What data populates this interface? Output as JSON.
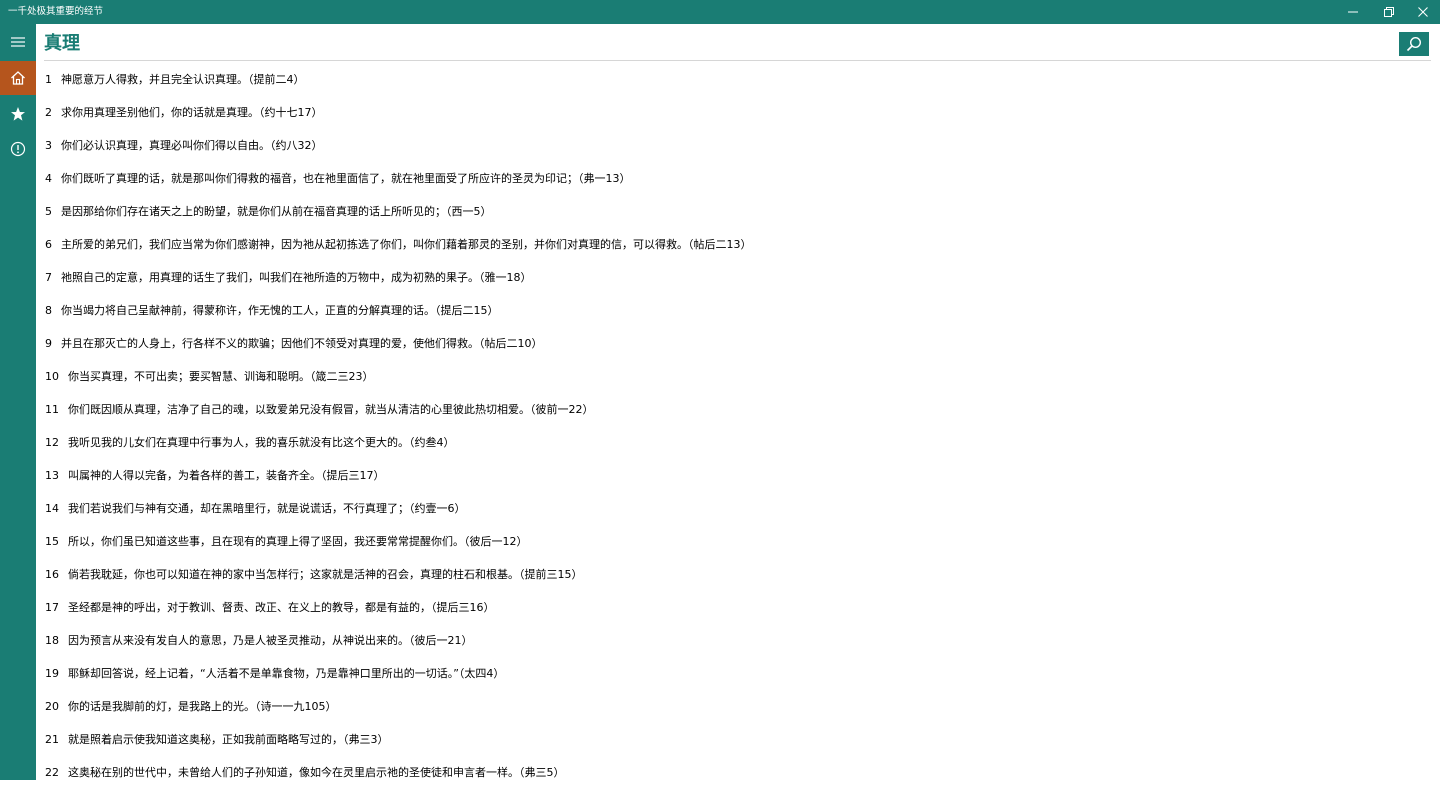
{
  "window": {
    "title": "一千处极其重要的经节",
    "controls": [
      {
        "name": "minimize-icon"
      },
      {
        "name": "restore-icon"
      },
      {
        "name": "close-icon"
      }
    ]
  },
  "sidebar": {
    "items": [
      {
        "name": "hamburger-menu-icon"
      },
      {
        "name": "home-icon",
        "active": true
      },
      {
        "name": "star-icon"
      },
      {
        "name": "info-icon"
      }
    ]
  },
  "header": {
    "title": "真理",
    "search_icon": "search-icon"
  },
  "colors": {
    "accent": "#1a7d74",
    "active_nav": "#b5551d",
    "background": "#ffffff"
  },
  "verses": [
    {
      "num": "1",
      "text": "神愿意万人得救，并且完全认识真理。（提前二4）"
    },
    {
      "num": "2",
      "text": "求你用真理圣别他们，你的话就是真理。（约十七17）"
    },
    {
      "num": "3",
      "text": "你们必认识真理，真理必叫你们得以自由。（约八32）"
    },
    {
      "num": "4",
      "text": "你们既听了真理的话，就是那叫你们得救的福音，也在祂里面信了，就在祂里面受了所应许的圣灵为印记；（弗一13）"
    },
    {
      "num": "5",
      "text": "是因那给你们存在诸天之上的盼望，就是你们从前在福音真理的话上所听见的；（西一5）"
    },
    {
      "num": "6",
      "text": "主所爱的弟兄们，我们应当常为你们感谢神，因为祂从起初拣选了你们，叫你们藉着那灵的圣别，并你们对真理的信，可以得救。（帖后二13）"
    },
    {
      "num": "7",
      "text": "祂照自己的定意，用真理的话生了我们，叫我们在祂所造的万物中，成为初熟的果子。（雅一18）"
    },
    {
      "num": "8",
      "text": "你当竭力将自己呈献神前，得蒙称许，作无愧的工人，正直的分解真理的话。（提后二15）"
    },
    {
      "num": "9",
      "text": "并且在那灭亡的人身上，行各样不义的欺骗；因他们不领受对真理的爱，使他们得救。（帖后二10）"
    },
    {
      "num": "10",
      "text": "你当买真理，不可出卖；要买智慧、训诲和聪明。（箴二三23）"
    },
    {
      "num": "11",
      "text": "你们既因顺从真理，洁净了自己的魂，以致爱弟兄没有假冒，就当从清洁的心里彼此热切相爱。（彼前一22）"
    },
    {
      "num": "12",
      "text": "我听见我的儿女们在真理中行事为人，我的喜乐就没有比这个更大的。（约叁4）"
    },
    {
      "num": "13",
      "text": "叫属神的人得以完备，为着各样的善工，装备齐全。（提后三17）"
    },
    {
      "num": "14",
      "text": "我们若说我们与神有交通，却在黑暗里行，就是说谎话，不行真理了；（约壹一6）"
    },
    {
      "num": "15",
      "text": "所以，你们虽已知道这些事，且在现有的真理上得了坚固，我还要常常提醒你们。（彼后一12）"
    },
    {
      "num": "16",
      "text": "倘若我耽延，你也可以知道在神的家中当怎样行；这家就是活神的召会，真理的柱石和根基。（提前三15）"
    },
    {
      "num": "17",
      "text": "圣经都是神的呼出，对于教训、督责、改正、在义上的教导，都是有益的，（提后三16）"
    },
    {
      "num": "18",
      "text": "因为预言从来没有发自人的意思，乃是人被圣灵推动，从神说出来的。（彼后一21）"
    },
    {
      "num": "19",
      "text": "耶稣却回答说，经上记着，“人活着不是单靠食物，乃是靠神口里所出的一切话。”（太四4）"
    },
    {
      "num": "20",
      "text": "你的话是我脚前的灯，是我路上的光。（诗一一九105）"
    },
    {
      "num": "21",
      "text": "就是照着启示使我知道这奥秘，正如我前面略略写过的，（弗三3）"
    },
    {
      "num": "22",
      "text": "这奥秘在别的世代中，未曾给人们的子孙知道，像如今在灵里启示祂的圣使徒和申言者一样。（弗三5）"
    }
  ]
}
